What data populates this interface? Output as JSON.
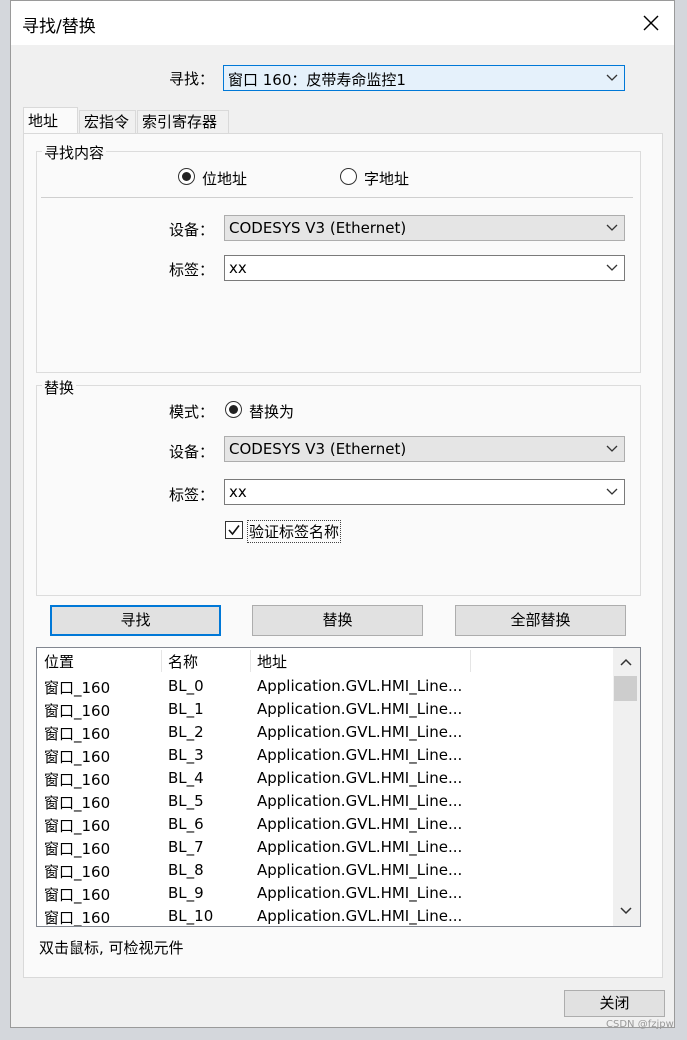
{
  "window": {
    "title": "寻找/替换"
  },
  "find": {
    "label": "寻找：",
    "target": "窗口 160：皮带寿命监控1"
  },
  "tabs": [
    {
      "label": "地址"
    },
    {
      "label": "宏指令"
    },
    {
      "label": "索引寄存器"
    }
  ],
  "search_group": {
    "title": "寻找内容",
    "radio_bit": "位地址",
    "radio_word": "字地址",
    "selected": "bit",
    "device_label": "设备：",
    "device_value": "CODESYS V3 (Ethernet)",
    "tag_label": "标签：",
    "tag_value": "xx"
  },
  "replace_group": {
    "title": "替换",
    "mode_label": "模式：",
    "mode_option": "替换为",
    "device_label": "设备：",
    "device_value": "CODESYS V3 (Ethernet)",
    "tag_label": "标签：",
    "tag_value": "xx",
    "verify_label": "验证标签名称",
    "verify_checked": true
  },
  "buttons": {
    "find": "寻找",
    "replace": "替换",
    "replace_all": "全部替换",
    "close": "关闭"
  },
  "results": {
    "columns": [
      "位置",
      "名称",
      "地址"
    ],
    "rows": [
      [
        "窗口_160",
        "BL_0",
        "Application.GVL.HMI_Line..."
      ],
      [
        "窗口_160",
        "BL_1",
        "Application.GVL.HMI_Line..."
      ],
      [
        "窗口_160",
        "BL_2",
        "Application.GVL.HMI_Line..."
      ],
      [
        "窗口_160",
        "BL_3",
        "Application.GVL.HMI_Line..."
      ],
      [
        "窗口_160",
        "BL_4",
        "Application.GVL.HMI_Line..."
      ],
      [
        "窗口_160",
        "BL_5",
        "Application.GVL.HMI_Line..."
      ],
      [
        "窗口_160",
        "BL_6",
        "Application.GVL.HMI_Line..."
      ],
      [
        "窗口_160",
        "BL_7",
        "Application.GVL.HMI_Line..."
      ],
      [
        "窗口_160",
        "BL_8",
        "Application.GVL.HMI_Line..."
      ],
      [
        "窗口_160",
        "BL_9",
        "Application.GVL.HMI_Line..."
      ],
      [
        "窗口_160",
        "BL_10",
        "Application.GVL.HMI_Line..."
      ]
    ]
  },
  "hint": "双击鼠标, 可检视元件",
  "watermark": "CSDN @fzjpw",
  "colors": {
    "accent": "#0078d7",
    "dialog_bg": "#f0f0f0",
    "panel_bg": "#fafafa"
  },
  "icons": {
    "close": "close-icon",
    "dropdown": "chevron-down-icon",
    "scroll_up": "chevron-up-icon",
    "scroll_down": "chevron-down-icon"
  }
}
